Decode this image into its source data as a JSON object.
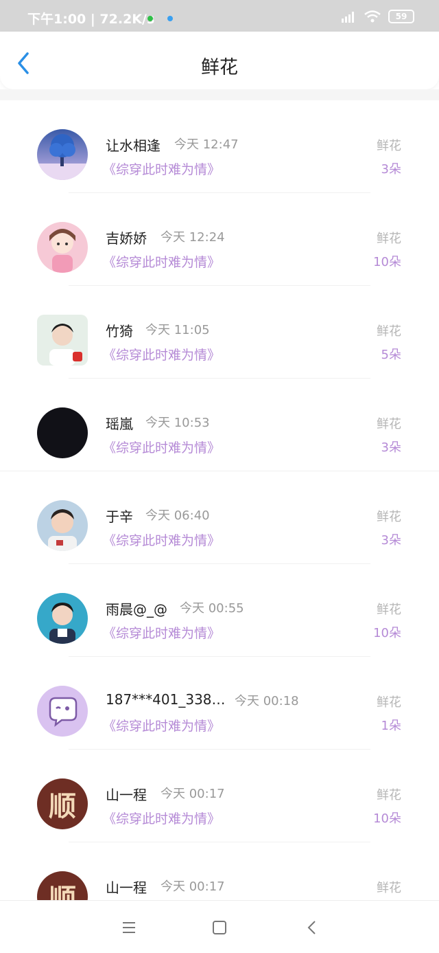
{
  "status_bar": {
    "left_text": "下午1:00 | 72.2K/s",
    "battery": "59"
  },
  "header": {
    "title": "鲜花"
  },
  "flowers": [
    {
      "name": "让水相逢",
      "time": "今天 12:47",
      "book": "《综穿此时难为情》",
      "label": "鲜花",
      "count": "3朵",
      "avatar": "tree-avatar"
    },
    {
      "name": "吉娇娇",
      "time": "今天 12:24",
      "book": "《综穿此时难为情》",
      "label": "鲜花",
      "count": "10朵",
      "avatar": "girl-avatar"
    },
    {
      "name": "竹猗",
      "time": "今天 11:05",
      "book": "《综穿此时难为情》",
      "label": "鲜花",
      "count": "5朵",
      "avatar": "boy-avatar"
    },
    {
      "name": "瑶嵐",
      "time": "今天 10:53",
      "book": "《综穿此时难为情》",
      "label": "鲜花",
      "count": "3朵",
      "avatar": "black-avatar"
    },
    {
      "name": "于辛",
      "time": "今天 06:40",
      "book": "《综穿此时难为情》",
      "label": "鲜花",
      "count": "3朵",
      "avatar": "child-avatar"
    },
    {
      "name": "雨晨@_@",
      "time": "今天 00:55",
      "book": "《综穿此时难为情》",
      "label": "鲜花",
      "count": "10朵",
      "avatar": "man-avatar"
    },
    {
      "name": "187***401_338…",
      "time": "今天 00:18",
      "book": "《综穿此时难为情》",
      "label": "鲜花",
      "count": "1朵",
      "avatar": "chat-bubble-avatar"
    },
    {
      "name": "山一程",
      "time": "今天 00:17",
      "book": "《综穿此时难为情》",
      "label": "鲜花",
      "count": "10朵",
      "avatar": "shun-avatar",
      "avatar_text": "顺"
    },
    {
      "name": "山一程",
      "time": "今天 00:17",
      "book": "",
      "label": "鲜花",
      "count": "",
      "avatar": "shun-avatar",
      "avatar_text": "顺"
    }
  ],
  "colors": {
    "accent_purple": "#b58ad6",
    "back_blue": "#2a8fe6",
    "status_bar_bg": "#d6d6d6"
  }
}
